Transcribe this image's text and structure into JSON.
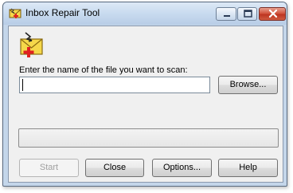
{
  "window": {
    "title": "Inbox Repair Tool",
    "title_icon": "envelope-repair-icon",
    "controls": {
      "minimize_icon": "minimize-icon",
      "maximize_icon": "maximize-icon",
      "close_icon": "close-icon"
    }
  },
  "main": {
    "app_icon": "envelope-repair-icon",
    "prompt": "Enter the name of the file you want to scan:",
    "file_input": {
      "value": "",
      "placeholder": ""
    },
    "browse_label": "Browse...",
    "progress": {
      "fraction": 0
    }
  },
  "buttons": {
    "start_label": "Start",
    "close_label": "Close",
    "options_label": "Options...",
    "help_label": "Help"
  },
  "colors": {
    "close_button_red": "#c4432d",
    "progress_green": "#37c02b",
    "envelope_yellow": "#f5d84a",
    "repair_cross_red": "#e02020"
  }
}
